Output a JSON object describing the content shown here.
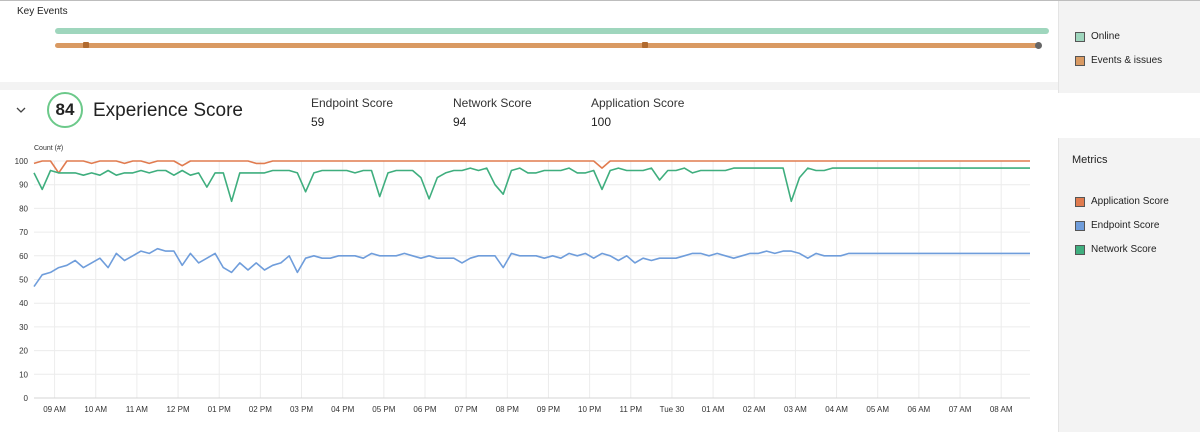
{
  "key_events": {
    "title": "Key Events",
    "legend": [
      {
        "label": "Online",
        "color": "#9fd6bd"
      },
      {
        "label": "Events & issues",
        "color": "#d99a63"
      }
    ]
  },
  "experience": {
    "score": "84",
    "title": "Experience Score",
    "metrics": [
      {
        "label": "Endpoint Score",
        "value": "59"
      },
      {
        "label": "Network Score",
        "value": "94"
      },
      {
        "label": "Application Score",
        "value": "100"
      }
    ]
  },
  "metrics_panel": {
    "title": "Metrics",
    "legend": [
      {
        "label": "Application Score",
        "color": "#e07b4f"
      },
      {
        "label": "Endpoint Score",
        "color": "#6f9ddb"
      },
      {
        "label": "Network Score",
        "color": "#3fae7e"
      }
    ]
  },
  "chart_data": {
    "type": "line",
    "ylabel": "Count (#)",
    "ylim": [
      0,
      100
    ],
    "yticks": [
      0,
      10,
      20,
      30,
      40,
      50,
      60,
      70,
      80,
      90,
      100
    ],
    "xticks": [
      "09 AM",
      "10 AM",
      "11 AM",
      "12 PM",
      "01 PM",
      "02 PM",
      "03 PM",
      "04 PM",
      "05 PM",
      "06 PM",
      "07 PM",
      "08 PM",
      "09 PM",
      "10 PM",
      "11 PM",
      "Tue 30",
      "01 AM",
      "02 AM",
      "03 AM",
      "04 AM",
      "05 AM",
      "06 AM",
      "07 AM",
      "08 AM"
    ],
    "x": [
      0.0,
      0.2,
      0.4,
      0.6,
      0.8,
      1.0,
      1.2,
      1.4,
      1.6,
      1.8,
      2.0,
      2.2,
      2.4,
      2.6,
      2.8,
      3.0,
      3.2,
      3.4,
      3.6,
      3.8,
      4.0,
      4.2,
      4.4,
      4.6,
      4.8,
      5.0,
      5.2,
      5.4,
      5.6,
      5.8,
      6.0,
      6.2,
      6.4,
      6.6,
      6.8,
      7.0,
      7.2,
      7.4,
      7.6,
      7.8,
      8.0,
      8.2,
      8.4,
      8.6,
      8.8,
      9.0,
      9.2,
      9.4,
      9.6,
      9.8,
      10.0,
      10.2,
      10.4,
      10.6,
      10.8,
      11.0,
      11.2,
      11.4,
      11.6,
      11.8,
      12.0,
      12.2,
      12.4,
      12.6,
      12.8,
      13.0,
      13.2,
      13.4,
      13.6,
      13.8,
      14.0,
      14.2,
      14.4,
      14.6,
      14.8,
      15.0,
      15.2,
      15.4,
      15.6,
      15.8,
      16.0,
      16.2,
      16.4,
      16.6,
      16.8,
      17.0,
      17.2,
      17.4,
      17.6,
      17.8,
      18.0,
      18.2,
      18.4,
      18.6,
      18.8,
      19.0,
      19.2,
      19.4,
      19.6,
      19.8,
      20.0,
      20.2,
      20.4,
      20.6,
      20.8,
      21.0,
      21.2,
      21.4,
      21.6,
      21.8,
      22.0,
      22.2,
      22.4,
      22.6,
      22.8,
      23.0,
      23.2,
      23.4,
      23.6,
      23.8,
      24.0,
      24.2
    ],
    "series": [
      {
        "name": "Application Score",
        "color": "#e07b4f",
        "values": [
          99,
          100,
          100,
          95,
          100,
          100,
          100,
          99,
          100,
          100,
          100,
          99,
          100,
          100,
          99,
          100,
          100,
          100,
          98,
          100,
          100,
          100,
          100,
          100,
          100,
          100,
          100,
          99,
          99,
          100,
          100,
          100,
          100,
          100,
          100,
          100,
          100,
          100,
          100,
          100,
          100,
          100,
          100,
          100,
          100,
          100,
          100,
          100,
          100,
          100,
          100,
          100,
          100,
          100,
          100,
          100,
          100,
          100,
          100,
          100,
          100,
          100,
          100,
          100,
          100,
          100,
          100,
          100,
          100,
          97,
          100,
          100,
          100,
          100,
          100,
          100,
          100,
          100,
          100,
          100,
          100,
          100,
          100,
          100,
          100,
          100,
          100,
          100,
          100,
          100,
          100,
          100,
          100,
          100,
          100,
          100,
          100,
          100,
          100,
          100,
          100,
          100,
          100,
          100,
          100,
          100,
          100,
          100,
          100,
          100,
          100,
          100,
          100,
          100,
          100,
          100,
          100,
          100,
          100,
          100,
          100,
          100
        ]
      },
      {
        "name": "Endpoint Score",
        "color": "#6f9ddb",
        "values": [
          47,
          52,
          53,
          55,
          56,
          58,
          55,
          57,
          59,
          55,
          61,
          58,
          60,
          62,
          61,
          63,
          62,
          62,
          56,
          61,
          57,
          59,
          61,
          55,
          53,
          57,
          54,
          57,
          54,
          56,
          57,
          60,
          53,
          59,
          60,
          59,
          59,
          60,
          60,
          60,
          59,
          61,
          60,
          60,
          60,
          61,
          60,
          59,
          60,
          59,
          59,
          59,
          57,
          59,
          60,
          60,
          60,
          55,
          61,
          60,
          60,
          60,
          59,
          60,
          59,
          61,
          60,
          61,
          59,
          61,
          60,
          58,
          60,
          57,
          59,
          58,
          59,
          59,
          59,
          60,
          61,
          61,
          60,
          61,
          60,
          59,
          60,
          61,
          61,
          62,
          61,
          62,
          62,
          61,
          59,
          61,
          60,
          60,
          60,
          61,
          61,
          61,
          61,
          61,
          61,
          61,
          61,
          61,
          61,
          61,
          61,
          61,
          61,
          61,
          61,
          61,
          61,
          61,
          61,
          61,
          61,
          61
        ]
      },
      {
        "name": "Network Score",
        "color": "#3fae7e",
        "values": [
          95,
          88,
          96,
          95,
          95,
          95,
          94,
          95,
          94,
          96,
          94,
          95,
          95,
          96,
          95,
          96,
          96,
          94,
          96,
          94,
          95,
          89,
          95,
          95,
          83,
          95,
          95,
          95,
          95,
          96,
          96,
          96,
          95,
          87,
          95,
          96,
          96,
          96,
          96,
          95,
          96,
          96,
          85,
          95,
          96,
          96,
          96,
          93,
          84,
          93,
          95,
          96,
          96,
          97,
          96,
          97,
          90,
          86,
          96,
          97,
          95,
          95,
          96,
          96,
          96,
          97,
          95,
          95,
          96,
          88,
          96,
          97,
          96,
          96,
          96,
          97,
          92,
          96,
          96,
          97,
          95,
          96,
          96,
          96,
          96,
          97,
          97,
          97,
          97,
          97,
          97,
          97,
          83,
          93,
          97,
          96,
          96,
          97,
          97,
          97,
          97,
          97,
          97,
          97,
          97,
          97,
          97,
          97,
          97,
          97,
          97,
          97,
          97,
          97,
          97,
          97,
          97,
          97,
          97,
          97,
          97,
          97
        ]
      }
    ]
  }
}
